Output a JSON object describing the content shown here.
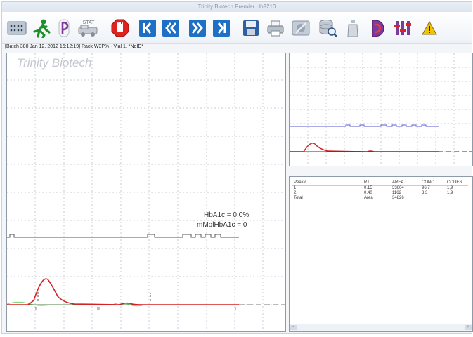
{
  "window": {
    "title": "Trinity Biotech Premier Hb9210"
  },
  "toolbar": {
    "buttons": [
      {
        "name": "grid-icon"
      },
      {
        "name": "run-icon"
      },
      {
        "name": "report-icon"
      },
      {
        "name": "stat-icon",
        "label": "STAT"
      },
      {
        "name": "stop-icon"
      },
      {
        "name": "first-icon"
      },
      {
        "name": "previous-icon"
      },
      {
        "name": "next-icon"
      },
      {
        "name": "last-icon"
      },
      {
        "name": "save-icon"
      },
      {
        "name": "print-icon"
      },
      {
        "name": "calibration-icon"
      },
      {
        "name": "database-search-icon"
      },
      {
        "name": "reagent-bottle-icon"
      },
      {
        "name": "head-icon"
      },
      {
        "name": "maintenance-icon"
      },
      {
        "name": "warning-icon"
      }
    ],
    "colors": {
      "blue": "#1f6fc4",
      "green": "#1f8f2a",
      "red": "#e0221e",
      "purple": "#7d3a9b",
      "warning": "#f2c200"
    }
  },
  "status_bar": {
    "text": "[Batch 380 Jan 12, 2012 16:12:19]  Rack W3P% - Vial 1, *NoID*"
  },
  "main_chart": {
    "watermark": "Trinity Biotech",
    "result_hba1c": "HbA1c = 0.0%",
    "result_mmol": "mMolHbA1c = 0",
    "peak_marks": [
      "I",
      "II",
      "I"
    ],
    "colors": {
      "signal": "#d42121",
      "baseline": "#4f7f45",
      "fit": "#6fd06f",
      "valve": "#555555"
    }
  },
  "mini_chart": {
    "colors": {
      "signal": "#d42121",
      "valve": "#5a5ad6",
      "baseline": "#333333"
    }
  },
  "peak_table": {
    "headers": [
      "Peak#",
      "RT",
      "AREA",
      "CONC",
      "CODES"
    ],
    "rows": [
      [
        "1",
        "0.15",
        "33664",
        "96.7",
        "1,9"
      ],
      [
        "2",
        "0.40",
        "1162",
        "3.3",
        "1,9"
      ],
      [
        "Total",
        "Area",
        "34826",
        "",
        ""
      ]
    ]
  },
  "scrollbar": {
    "left_arrow": "<",
    "right_arrow": ">"
  }
}
